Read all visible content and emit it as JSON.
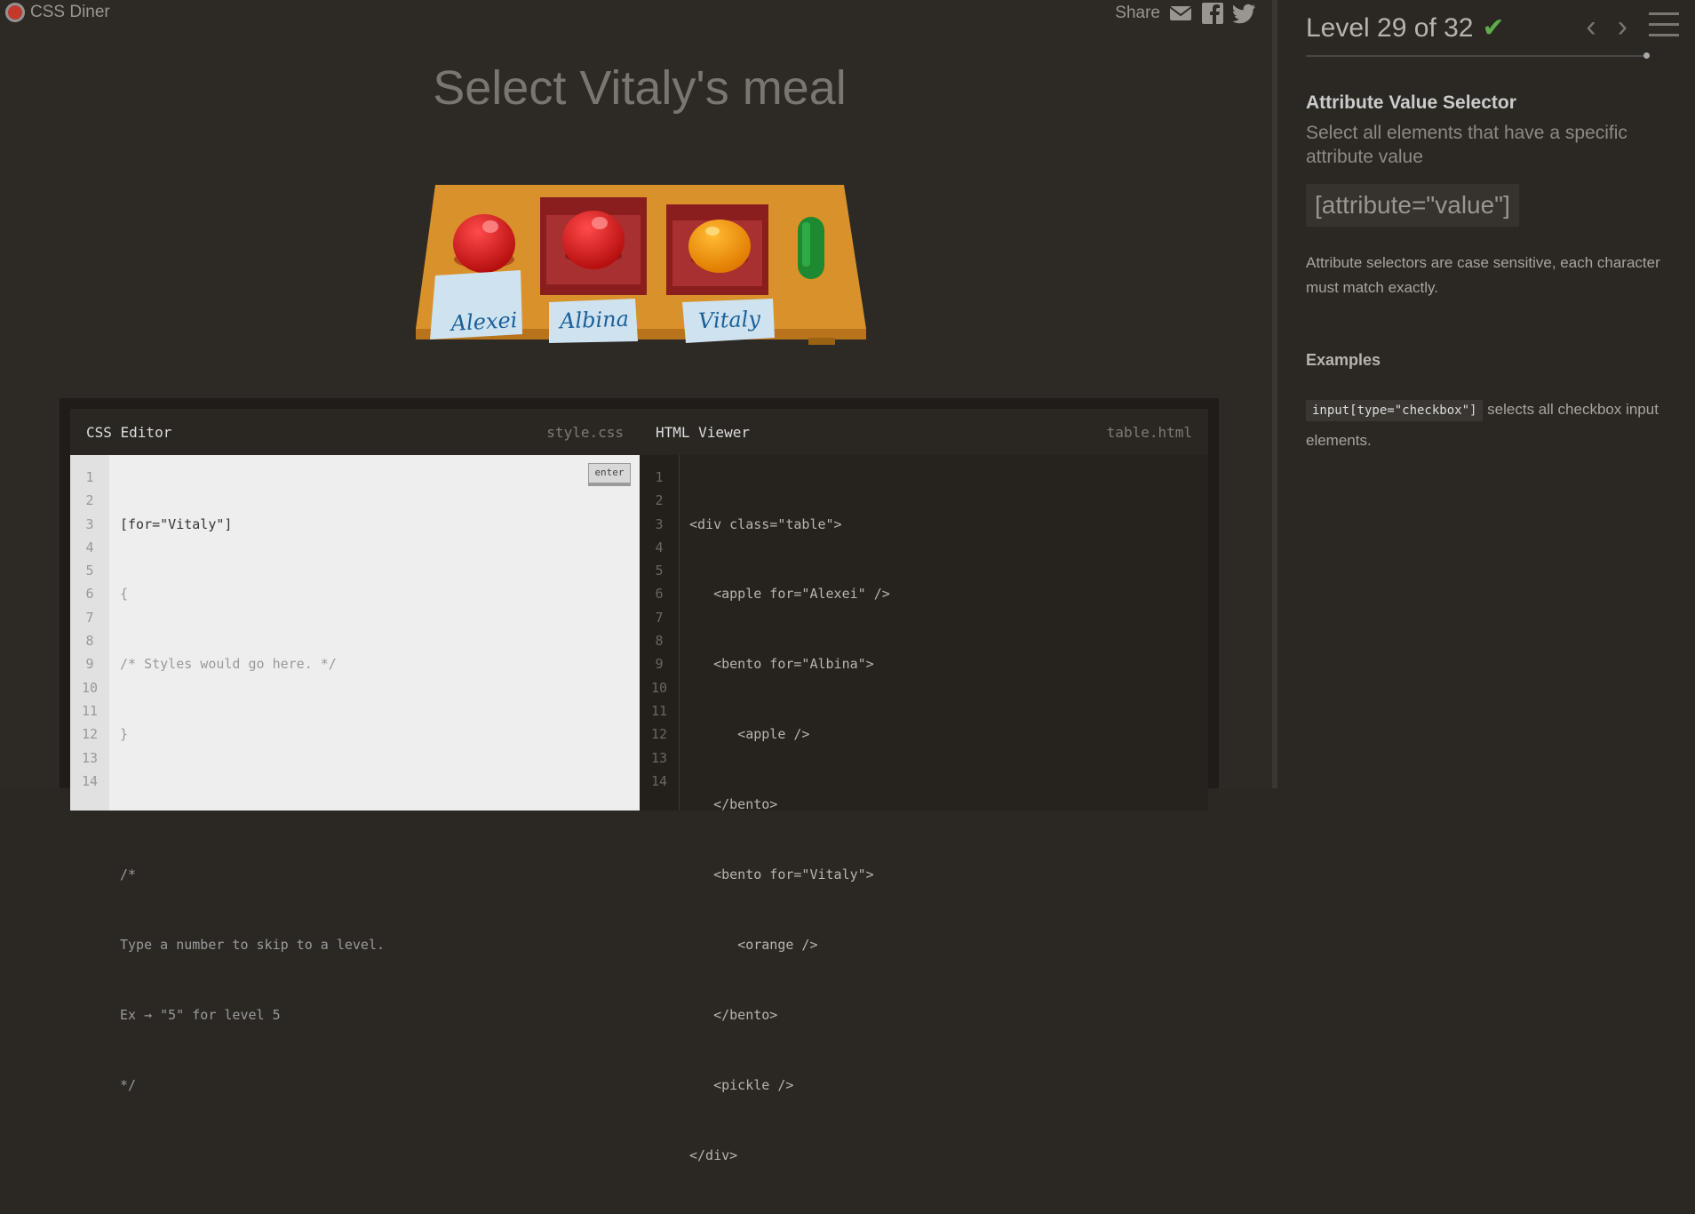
{
  "header": {
    "logo_text": "CSS Diner",
    "share_label": "Share",
    "share_icons": [
      "email-icon",
      "facebook-icon",
      "twitter-icon"
    ]
  },
  "game": {
    "instruction": "Select Vitaly's meal",
    "name_tags": [
      "Alexei",
      "Albina",
      "Vitaly"
    ]
  },
  "css_editor": {
    "title": "CSS Editor",
    "filename": "style.css",
    "enter_label": "enter",
    "line_numbers": [
      "1",
      "2",
      "3",
      "4",
      "5",
      "6",
      "7",
      "8",
      "9",
      "10",
      "11",
      "12",
      "13",
      "14"
    ],
    "input_value": "[for=\"Vitaly\"]",
    "lines": [
      "{",
      "/* Styles would go here. */",
      "}",
      "",
      "/*",
      "Type a number to skip to a level.",
      "Ex → \"5\" for level 5",
      "*/"
    ]
  },
  "html_viewer": {
    "title": "HTML Viewer",
    "filename": "table.html",
    "line_numbers": [
      "1",
      "2",
      "3",
      "4",
      "5",
      "6",
      "7",
      "8",
      "9",
      "10",
      "11",
      "12",
      "13",
      "14"
    ],
    "lines": [
      "<div class=\"table\">",
      "   <apple for=\"Alexei\" />",
      "   <bento for=\"Albina\">",
      "      <apple />",
      "   </bento>",
      "   <bento for=\"Vitaly\">",
      "      <orange />",
      "   </bento>",
      "   <pickle />",
      "</div>"
    ]
  },
  "sidebar": {
    "level_text": "Level 29 of 32",
    "level_complete": true,
    "selector_title": "Attribute Value Selector",
    "selector_subtitle": "Select all elements that have a specific attribute value",
    "syntax": "[attribute=\"value\"]",
    "hint": "Attribute selectors are case sensitive, each character must match exactly.",
    "examples_heading": "Examples",
    "example_code": "input[type=\"checkbox\"]",
    "example_text": "selects all checkbox input elements."
  }
}
